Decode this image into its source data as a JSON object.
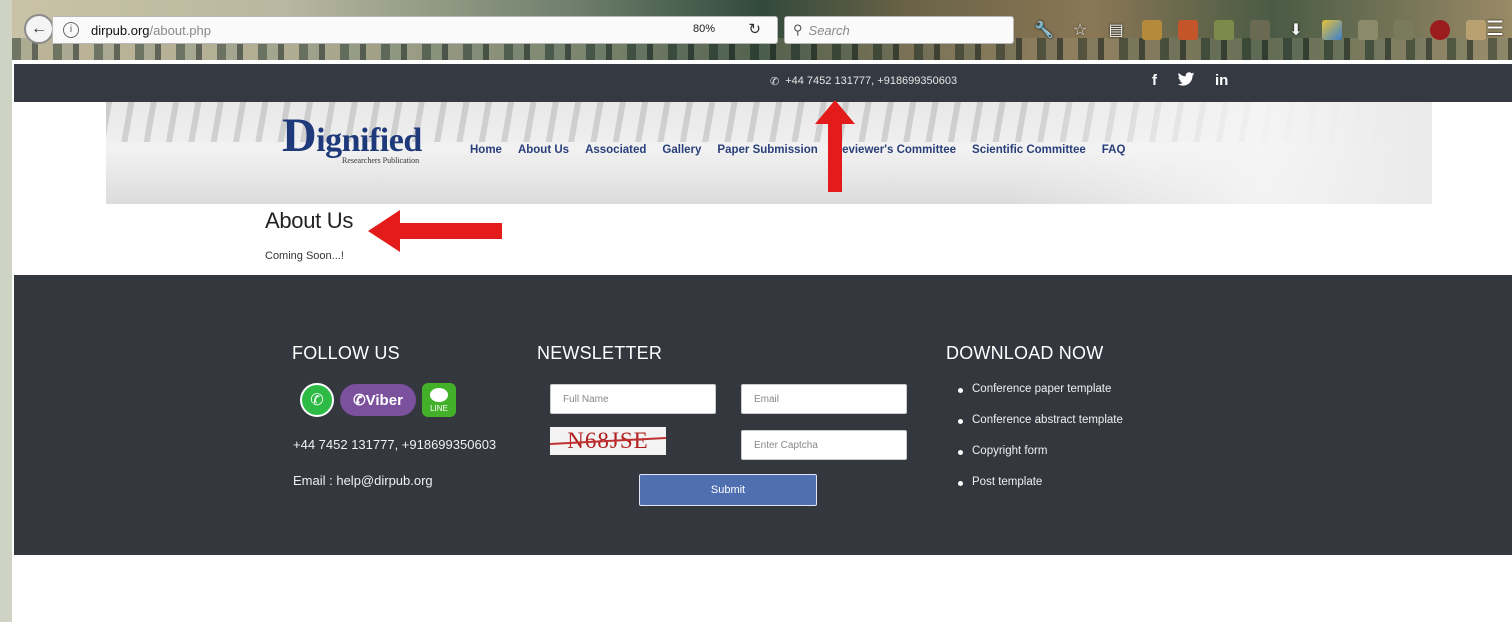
{
  "browser": {
    "url_host": "dirpub.org",
    "url_path": "/about.php",
    "zoom": "80%",
    "search_placeholder": "Search"
  },
  "topbar": {
    "phone": "+44 7452 131777, +918699350603",
    "social": [
      "f",
      "in"
    ]
  },
  "logo": {
    "initial": "D",
    "word": "ignified",
    "subtitle": "Researchers Publication"
  },
  "nav": {
    "items": [
      "Home",
      "About Us",
      "Associated",
      "Gallery",
      "Paper Submission",
      "Reviewer's Committee",
      "Scientific Committee",
      "FAQ"
    ]
  },
  "about": {
    "title": "About Us",
    "text": "Coming Soon...!"
  },
  "footer": {
    "follow": {
      "title": "FOLLOW US",
      "viber_label": "Viber",
      "line_label": "LINE",
      "phone": "+44 7452 131777, +918699350603",
      "email": "Email : help@dirpub.org"
    },
    "newsletter": {
      "title": "NEWSLETTER",
      "fullname_placeholder": "Full Name",
      "email_placeholder": "Email",
      "captcha_text": "N68JSE",
      "captcha_placeholder": "Enter Captcha",
      "submit_label": "Submit"
    },
    "download": {
      "title": "DOWNLOAD NOW",
      "items": [
        "Conference paper template",
        "Conference abstract template",
        "Copyright form",
        "Post template"
      ]
    }
  },
  "colors": {
    "topbar_bg": "#353941",
    "footer_bg": "#34373e",
    "nav_text": "#2a3f7a",
    "arrow_red": "#e31b1b",
    "submit_bg": "#4f6fb0"
  }
}
